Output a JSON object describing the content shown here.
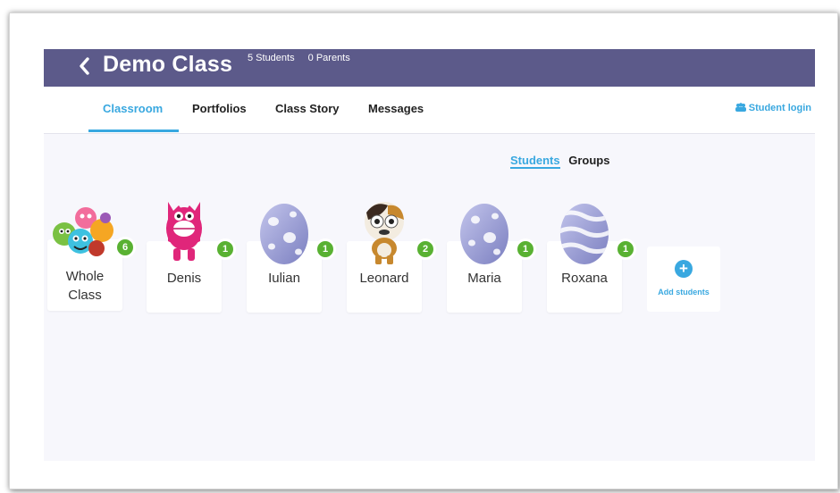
{
  "header": {
    "class_name": "Demo Class",
    "students_count": "5 Students",
    "parents_count": "0 Parents",
    "back_icon": "chevron-left-icon",
    "bg_color": "#5c5a8a"
  },
  "nav": {
    "tabs": [
      {
        "label": "Classroom",
        "active": true
      },
      {
        "label": "Portfolios",
        "active": false
      },
      {
        "label": "Class Story",
        "active": false
      },
      {
        "label": "Messages",
        "active": false
      }
    ],
    "student_login": "Student login",
    "accent_color": "#39a8e0"
  },
  "view_toggle": {
    "students": "Students",
    "groups": "Groups",
    "selected": "Students"
  },
  "cards": [
    {
      "name": "Whole",
      "name2": "Class",
      "points": "6",
      "avatar": "whole-class-monsters-icon"
    },
    {
      "name": "Denis",
      "points": "1",
      "avatar": "pink-monster-icon"
    },
    {
      "name": "Iulian",
      "points": "1",
      "avatar": "spotted-egg-icon"
    },
    {
      "name": "Leonard",
      "points": "2",
      "avatar": "hamster-monster-icon"
    },
    {
      "name": "Maria",
      "points": "1",
      "avatar": "spotted-egg-icon"
    },
    {
      "name": "Roxana",
      "points": "1",
      "avatar": "striped-egg-icon"
    }
  ],
  "add_students": {
    "label": "Add students",
    "icon": "plus-circle-icon"
  },
  "badge_color": "#59b132"
}
